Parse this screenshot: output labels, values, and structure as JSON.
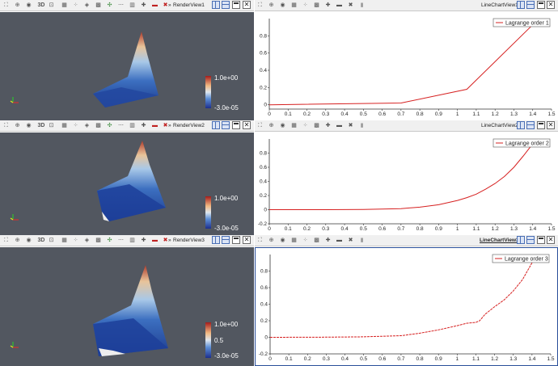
{
  "colors": {
    "render_bg": "#525760",
    "chart_line": "#d62020",
    "toolbar_bg": "#f0f0f0",
    "active_border": "#2a4f9a"
  },
  "toolbar_icons": [
    "reset-camera-icon",
    "zoom-data-icon",
    "camera-capture-icon",
    "toggle-3d-icon",
    "zoom-to-box-icon",
    "select-cells-icon",
    "select-points-icon",
    "select-frustum-icon",
    "select-block-icon",
    "interactive-select-icon",
    "hover-points-icon",
    "hover-cells-icon",
    "grow-selection-icon",
    "shrink-selection-icon",
    "clear-selection-icon"
  ],
  "toolbar_3d_label": "3D",
  "split_prefix": "»",
  "close_glyph": "✕",
  "views": [
    {
      "render_title": "RenderView1",
      "chart_title": "LineChartView1",
      "chart_active": false,
      "colorbar": {
        "max_label": "1.0e+00",
        "mid_label": "",
        "min_label": "-3.0e-05"
      }
    },
    {
      "render_title": "RenderView2",
      "chart_title": "LineChartView2",
      "chart_active": false,
      "colorbar": {
        "max_label": "1.0e+00",
        "mid_label": "",
        "min_label": "-3.0e-05"
      }
    },
    {
      "render_title": "RenderView3",
      "chart_title": "LineChartView3",
      "chart_active": true,
      "colorbar": {
        "max_label": "1.0e+00",
        "mid_label": "0.5",
        "min_label": "-3.0e-05"
      }
    }
  ],
  "chart_data": [
    {
      "type": "line",
      "xlim": [
        0,
        1.5
      ],
      "ylim": [
        -0.05,
        1.0
      ],
      "xticks": [
        "0",
        "0.1",
        "0.2",
        "0.3",
        "0.4",
        "0.5",
        "0.6",
        "0.7",
        "0.8",
        "0.9",
        "1",
        "1.1",
        "1.2",
        "1.3",
        "1.4",
        "1.5"
      ],
      "yticks": [
        "0",
        "0.2",
        "0.4",
        "0.6",
        "0.8"
      ],
      "ytick_values": [
        0,
        0.2,
        0.4,
        0.6,
        0.8
      ],
      "legend_position": "top-right",
      "grid": false,
      "series": [
        {
          "name": "Lagrange order 1",
          "style": "solid",
          "x": [
            0,
            0.7,
            1.05,
            1.41
          ],
          "y": [
            0,
            0.02,
            0.18,
            0.95
          ]
        }
      ]
    },
    {
      "type": "line",
      "xlim": [
        0,
        1.5
      ],
      "ylim": [
        -0.2,
        1.0
      ],
      "xticks": [
        "0",
        "0.1",
        "0.2",
        "0.3",
        "0.4",
        "0.5",
        "0.6",
        "0.7",
        "0.8",
        "0.9",
        "1",
        "1.1",
        "1.2",
        "1.3",
        "1.4",
        "1.5"
      ],
      "yticks": [
        "-0.2",
        "0",
        "0.2",
        "0.4",
        "0.6",
        "0.8"
      ],
      "ytick_values": [
        -0.2,
        0,
        0.2,
        0.4,
        0.6,
        0.8
      ],
      "legend_position": "top-right",
      "grid": false,
      "series": [
        {
          "name": "Lagrange order 2",
          "style": "solid",
          "x": [
            0,
            0.3,
            0.5,
            0.7,
            0.8,
            0.9,
            1.0,
            1.05,
            1.1,
            1.15,
            1.2,
            1.25,
            1.3,
            1.35,
            1.4
          ],
          "y": [
            0,
            0,
            0.003,
            0.015,
            0.035,
            0.07,
            0.13,
            0.17,
            0.22,
            0.29,
            0.37,
            0.47,
            0.6,
            0.76,
            0.93
          ]
        }
      ]
    },
    {
      "type": "line",
      "xlim": [
        0,
        1.5
      ],
      "ylim": [
        -0.2,
        1.0
      ],
      "xticks": [
        "0",
        "0.1",
        "0.2",
        "0.3",
        "0.4",
        "0.5",
        "0.6",
        "0.7",
        "0.8",
        "0.9",
        "1",
        "1.1",
        "1.2",
        "1.3",
        "1.4",
        "1.5"
      ],
      "yticks": [
        "-0.2",
        "0",
        "0.2",
        "0.4",
        "0.6",
        "0.8"
      ],
      "ytick_values": [
        -0.2,
        0,
        0.2,
        0.4,
        0.6,
        0.8
      ],
      "legend_position": "top-right",
      "grid": false,
      "series": [
        {
          "name": "Lagrange order 3",
          "style": "dashed",
          "x": [
            0,
            0.3,
            0.5,
            0.7,
            0.8,
            0.9,
            1.0,
            1.05,
            1.1,
            1.12,
            1.15,
            1.2,
            1.25,
            1.3,
            1.35,
            1.4
          ],
          "y": [
            0,
            0.002,
            0.006,
            0.02,
            0.05,
            0.09,
            0.14,
            0.17,
            0.18,
            0.2,
            0.28,
            0.37,
            0.45,
            0.56,
            0.7,
            0.9
          ]
        }
      ]
    }
  ]
}
